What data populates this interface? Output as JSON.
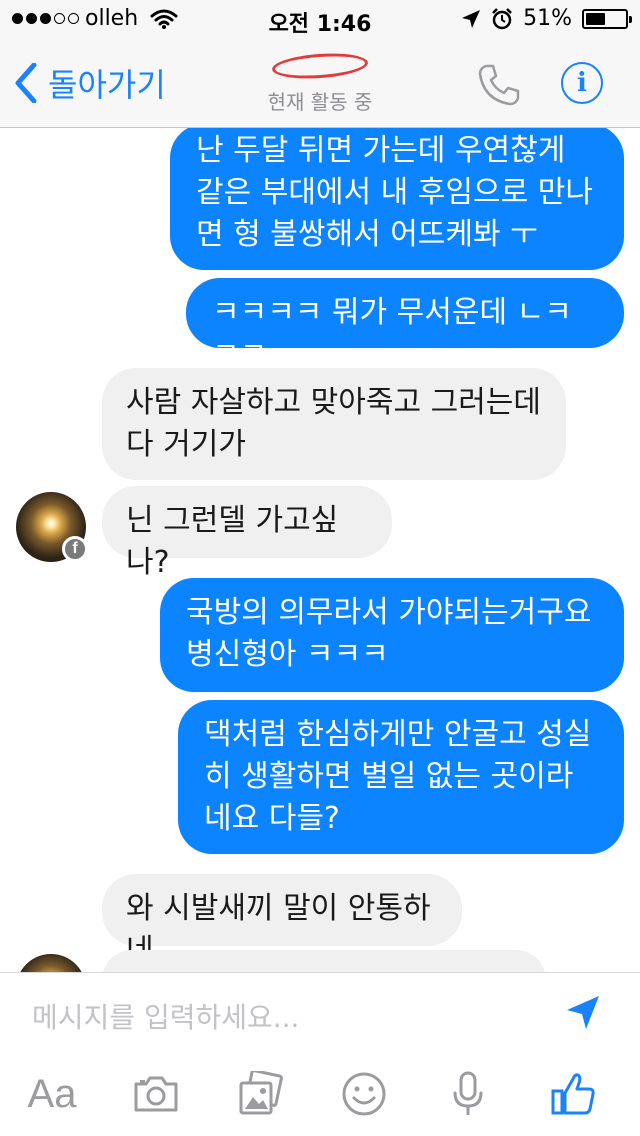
{
  "status_bar": {
    "carrier": "olleh",
    "time": "오전 1:46",
    "battery_text": "51%",
    "battery_level": 0.51,
    "signal_bars": 3
  },
  "nav": {
    "back_label": "돌아가기",
    "subtitle": "현재 활동 중"
  },
  "messages": [
    {
      "side": "sent",
      "text": "난 두달 뒤면 가는데 우연찮게 같은 부대에서 내 후임으로 만나면 형 불쌍해서 어뜨케봐 ㅜ"
    },
    {
      "side": "sent",
      "text": "ㅋㅋㅋㅋ 뭐가 무서운데 ㄴㅋㅋㅋ"
    },
    {
      "side": "recv",
      "text": "사람 자살하고 맞아죽고 그러는데다 거기가"
    },
    {
      "side": "recv",
      "text": "닌 그런델 가고싶나?"
    },
    {
      "side": "sent",
      "text": "국방의 의무라서 가야되는거구요 병신형아 ㅋㅋㅋ"
    },
    {
      "side": "sent",
      "text": "댁처럼 한심하게만 안굴고 성실히 생활하면 별일 없는 곳이라네요 다들?"
    },
    {
      "side": "recv",
      "text": "와 시발새끼 말이 안통하네"
    }
  ],
  "composer": {
    "placeholder": "메시지를 입력하세요...",
    "font_label": "Aa"
  },
  "colors": {
    "accent": "#1a82fb",
    "sent_bubble": "#0c84ff",
    "recv_bubble": "#f1f0f0"
  },
  "icons": [
    "back-chevron-icon",
    "phone-icon",
    "info-icon",
    "facebook-badge-icon",
    "send-icon",
    "camera-icon",
    "gallery-icon",
    "emoji-icon",
    "microphone-icon",
    "thumbs-up-icon"
  ]
}
